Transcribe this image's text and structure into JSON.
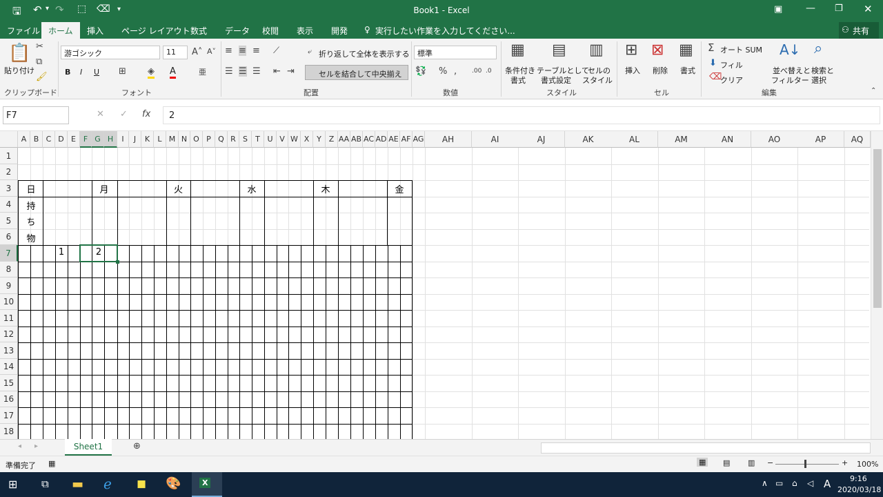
{
  "window": {
    "title": "Book1 - Excel",
    "user_icon": "share-person-icon"
  },
  "qat": {
    "save": "save-icon",
    "undo": "undo-icon",
    "redo": "redo-icon",
    "customize": "▾"
  },
  "tabs": [
    "ファイル",
    "ホーム",
    "挿入",
    "ページ レイアウト",
    "数式",
    "データ",
    "校閲",
    "表示",
    "開発"
  ],
  "tell_me": "実行したい作業を入力してください...",
  "share": "共有",
  "ribbon": {
    "clipboard": {
      "group": "クリップボード",
      "paste": "貼り付け"
    },
    "font": {
      "group": "フォント",
      "name": "游ゴシック",
      "size": "11",
      "bold": "B",
      "italic": "I",
      "underline": "U"
    },
    "alignment": {
      "group": "配置",
      "wrap": "折り返して全体を表示する",
      "merge": "セルを結合して中央揃え"
    },
    "number": {
      "group": "数値",
      "format": "標準"
    },
    "styles": {
      "group": "スタイル",
      "cond": "条件付き",
      "cond2": "書式",
      "table": "テーブルとして",
      "table2": "書式設定",
      "cell": "セルの",
      "cell2": "スタイル"
    },
    "cells": {
      "group": "セル",
      "insert": "挿入",
      "delete": "削除",
      "format": "書式"
    },
    "editing": {
      "group": "編集",
      "autosum": "オート SUM",
      "fill": "フィル",
      "clear": "クリア",
      "sort": "並べ替えと",
      "sort2": "フィルター",
      "find": "検索と",
      "find2": "選択"
    }
  },
  "formula": {
    "name_box": "F7",
    "fx": "fx",
    "value": "2"
  },
  "grid": {
    "narrow_cols": [
      "A",
      "B",
      "C",
      "D",
      "E",
      "F",
      "G",
      "H",
      "I",
      "J",
      "K",
      "L",
      "M",
      "N",
      "O",
      "P",
      "Q",
      "R",
      "S",
      "T",
      "U",
      "V",
      "W",
      "X",
      "Y",
      "Z",
      "AA",
      "AB",
      "AC",
      "AD",
      "AE",
      "AF",
      "AG"
    ],
    "wide_cols": [
      "AH",
      "AI",
      "AJ",
      "AK",
      "AL",
      "AM",
      "AN",
      "AO",
      "AP",
      "AQ"
    ],
    "rows": [
      "1",
      "2",
      "3",
      "4",
      "5",
      "6",
      "7",
      "8",
      "9",
      "10",
      "11",
      "12",
      "13",
      "14",
      "15",
      "16",
      "17",
      "18"
    ],
    "days": [
      "日",
      "月",
      "火",
      "水",
      "木",
      "金"
    ],
    "mochimono": [
      "持",
      "ち",
      "物"
    ],
    "c7": "1",
    "f7": "2"
  },
  "sheet": {
    "tab": "Sheet1"
  },
  "status": {
    "ready": "準備完了",
    "zoom": "100%"
  },
  "taskbar": {
    "time": "9:16",
    "date": "2020/03/18",
    "ime": "A"
  }
}
